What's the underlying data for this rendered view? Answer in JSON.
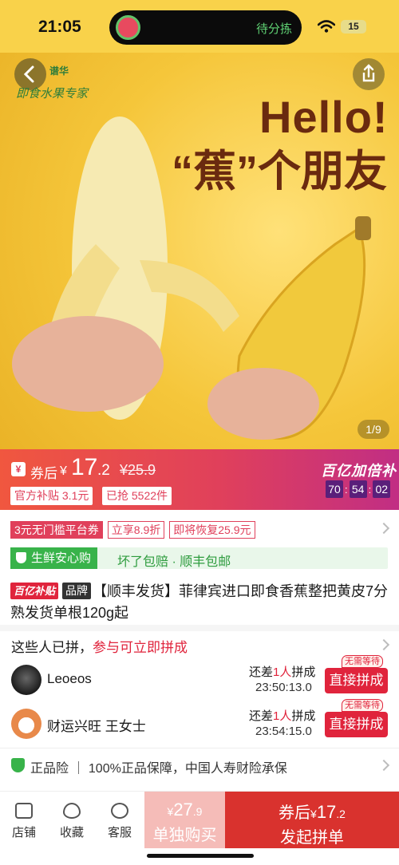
{
  "status_bar": {
    "time": "21:05",
    "island_text": "待分拣",
    "battery": "15"
  },
  "hero": {
    "brand_small": "谱华",
    "brand_logo": "即食水果专家",
    "headline": "Hello!",
    "slogan": "“蕉”个朋友",
    "page_indicator": "1/9"
  },
  "price": {
    "coupon_icon": "¥",
    "after_coupon_label": "券后",
    "currency": "¥",
    "main": "17",
    "decimal": ".2",
    "original": "¥25.9",
    "subsidy": "官方补贴 3.1元",
    "sold": "已抢 5522件",
    "campaign": "百亿加倍补",
    "countdown": [
      "70",
      "54",
      "02"
    ]
  },
  "coupons": [
    "3元无门槛平台券",
    "立享8.9折",
    "即将恢复25.9元"
  ],
  "guarantee": {
    "badge": "生鲜安心购",
    "text": "坏了包赔 · 顺丰包邮"
  },
  "title": {
    "badge1": "百亿补贴",
    "badge2": "品牌",
    "text": "【顺丰发货】菲律宾进口即食香蕉整把黄皮7分熟发货单根120g起"
  },
  "group": {
    "head": "这些人已拼，",
    "head_highlight": "参与可立即拼成",
    "rows": [
      {
        "name": "Leoeos",
        "need_prefix": "还差",
        "need_count": "1人",
        "need_suffix": "拼成",
        "remain": "23:50:13.0",
        "button": "直接拼成",
        "tag": "无需等待"
      },
      {
        "name": "财运兴旺 王女士",
        "need_prefix": "还差",
        "need_count": "1人",
        "need_suffix": "拼成",
        "remain": "23:54:15.0",
        "button": "直接拼成",
        "tag": "无需等待"
      }
    ]
  },
  "insurance": {
    "text": "正品险 ｜ 100%正品保障，中国人寿财险承保"
  },
  "bottom": {
    "tabs": [
      "店铺",
      "收藏",
      "客服"
    ],
    "solo": {
      "currency": "¥",
      "price": "27",
      "decimal": ".9",
      "label": "单独购买"
    },
    "group": {
      "prefix": "券后",
      "currency": "¥",
      "price": "17",
      "decimal": ".2",
      "label": "发起拼单"
    }
  },
  "colors": {
    "accent": "#e0243c",
    "hero_yellow": "#f5c63a",
    "green": "#38b34a"
  }
}
